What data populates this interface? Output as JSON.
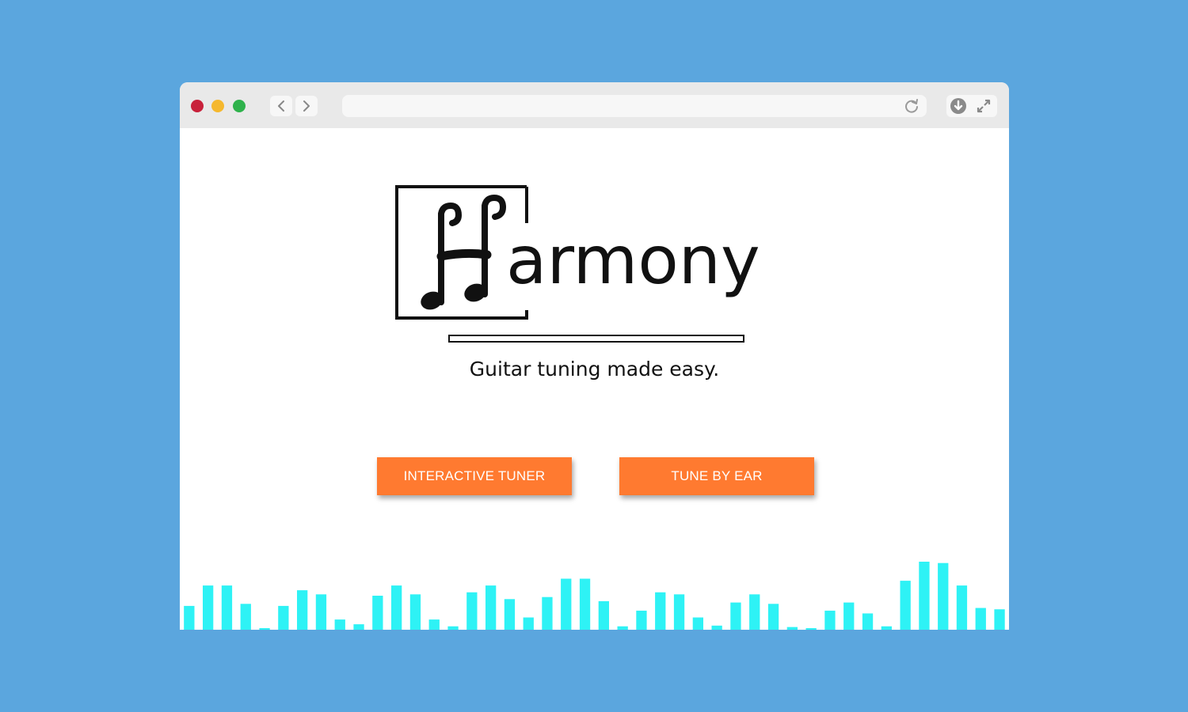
{
  "browser": {
    "url_value": "",
    "icons": {
      "back": "chevron-left-icon",
      "forward": "chevron-right-icon",
      "reload": "reload-icon",
      "download": "download-icon",
      "fullscreen": "fullscreen-icon"
    },
    "traffic_light_colors": [
      "#c8213b",
      "#f5b82e",
      "#2fb24c"
    ]
  },
  "hero": {
    "logo_text": "armony",
    "logo_initial": "H",
    "tagline": "Guitar tuning made easy."
  },
  "actions": {
    "interactive_tuner_label": "INTERACTIVE TUNER",
    "tune_by_ear_label": "TUNE BY EAR"
  },
  "colors": {
    "background": "#5ba6de",
    "accent": "#ff7a30",
    "equalizer": "#2ef2f5"
  },
  "equalizer": {
    "levels": [
      0.35,
      0.65,
      0.65,
      0.38,
      0.02,
      0.35,
      0.58,
      0.52,
      0.15,
      0.08,
      0.5,
      0.65,
      0.52,
      0.15,
      0.05,
      0.55,
      0.65,
      0.45,
      0.18,
      0.48,
      0.75,
      0.75,
      0.42,
      0.05,
      0.28,
      0.55,
      0.52,
      0.18,
      0.06,
      0.4,
      0.52,
      0.38,
      0.04,
      0.02,
      0.28,
      0.4,
      0.24,
      0.05,
      0.72,
      1.0,
      0.98,
      0.65,
      0.32,
      0.3
    ]
  }
}
